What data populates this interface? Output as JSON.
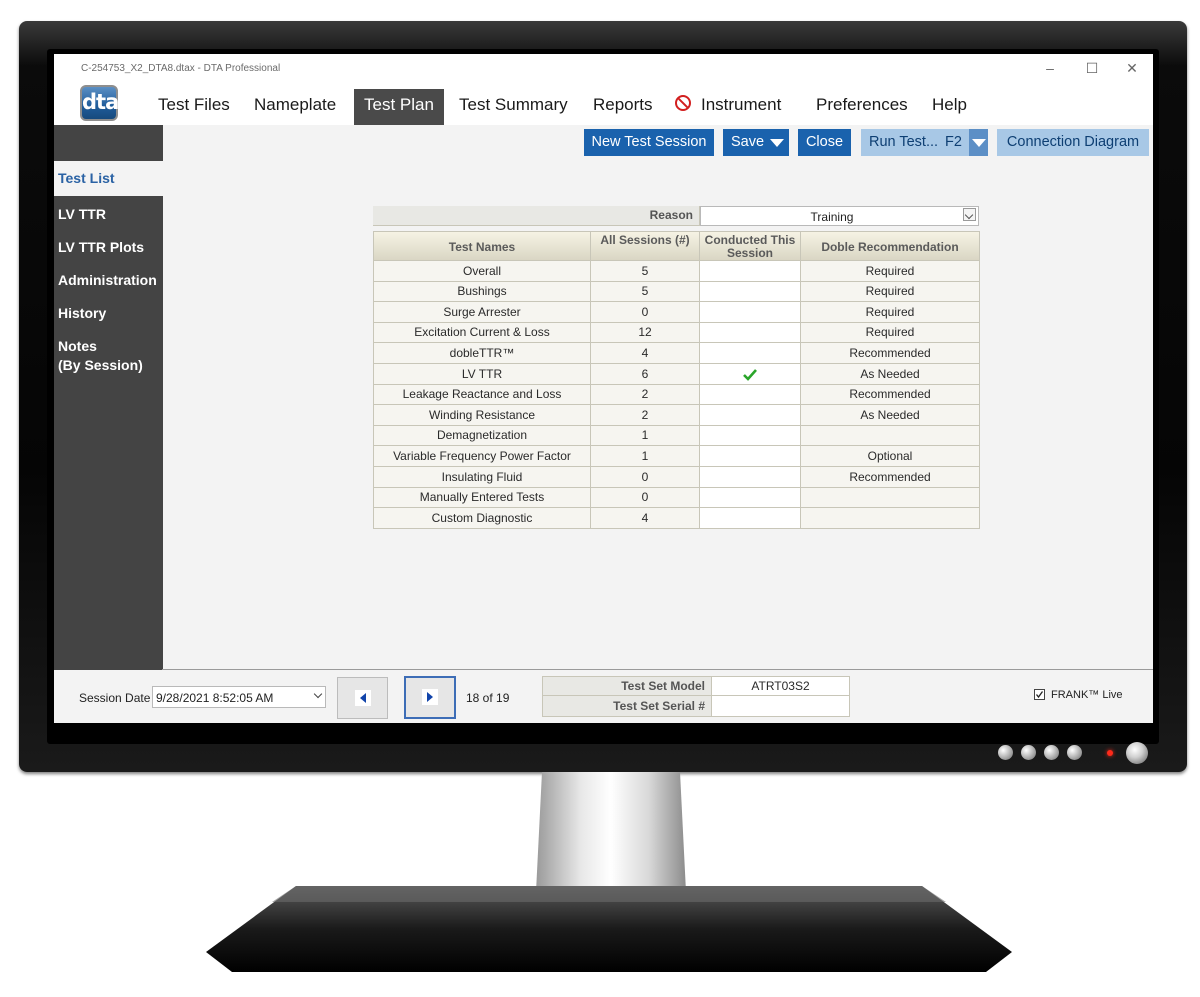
{
  "window": {
    "title": "C-254753_X2_DTA8.dtax - DTA Professional",
    "minimize": "–",
    "maximize": "☐",
    "close": "✕"
  },
  "logo": "dta",
  "menu": [
    "Test Files",
    "Nameplate",
    "Test Plan",
    "Test Summary",
    "Reports",
    "Instrument",
    "Preferences",
    "Help"
  ],
  "menu_active": "Test Plan",
  "toolbar": {
    "new_session": "New Test Session",
    "save": "Save",
    "close": "Close",
    "run_test": "Run Test...",
    "run_shortcut": "F2",
    "connection_diagram": "Connection Diagram"
  },
  "sidebar": {
    "active": "Test List",
    "items": [
      "LV TTR",
      "LV TTR Plots",
      "Administration",
      "History",
      "Notes",
      "(By Session)"
    ]
  },
  "reason": {
    "label": "Reason",
    "value": "Training"
  },
  "table": {
    "headers": [
      "Test Names",
      "All Sessions (#)",
      "Conducted This Session",
      "Doble Recommendation"
    ],
    "rows": [
      {
        "name": "Overall",
        "sessions": "5",
        "conducted": false,
        "rec": "Required"
      },
      {
        "name": "Bushings",
        "sessions": "5",
        "conducted": false,
        "rec": "Required"
      },
      {
        "name": "Surge Arrester",
        "sessions": "0",
        "conducted": false,
        "rec": "Required"
      },
      {
        "name": "Excitation Current & Loss",
        "sessions": "12",
        "conducted": false,
        "rec": "Required"
      },
      {
        "name": "dobleTTR™",
        "sessions": "4",
        "conducted": false,
        "rec": "Recommended"
      },
      {
        "name": "LV TTR",
        "sessions": "6",
        "conducted": true,
        "rec": "As Needed"
      },
      {
        "name": "Leakage Reactance and Loss",
        "sessions": "2",
        "conducted": false,
        "rec": "Recommended"
      },
      {
        "name": "Winding Resistance",
        "sessions": "2",
        "conducted": false,
        "rec": "As Needed"
      },
      {
        "name": "Demagnetization",
        "sessions": "1",
        "conducted": false,
        "rec": ""
      },
      {
        "name": "Variable Frequency Power Factor",
        "sessions": "1",
        "conducted": false,
        "rec": "Optional"
      },
      {
        "name": "Insulating Fluid",
        "sessions": "0",
        "conducted": false,
        "rec": "Recommended"
      },
      {
        "name": "Manually Entered Tests",
        "sessions": "0",
        "conducted": false,
        "rec": ""
      },
      {
        "name": "Custom Diagnostic",
        "sessions": "4",
        "conducted": false,
        "rec": ""
      }
    ]
  },
  "footer": {
    "session_date_label": "Session Date",
    "session_date": "9/28/2021 8:52:05 AM",
    "pager": "18 of 19",
    "test_set_model_label": "Test Set Model",
    "test_set_model": "ATRT03S2",
    "test_set_serial_label": "Test Set Serial #",
    "test_set_serial": "",
    "frank_live": "FRANK™ Live",
    "frank_live_checked": true
  }
}
